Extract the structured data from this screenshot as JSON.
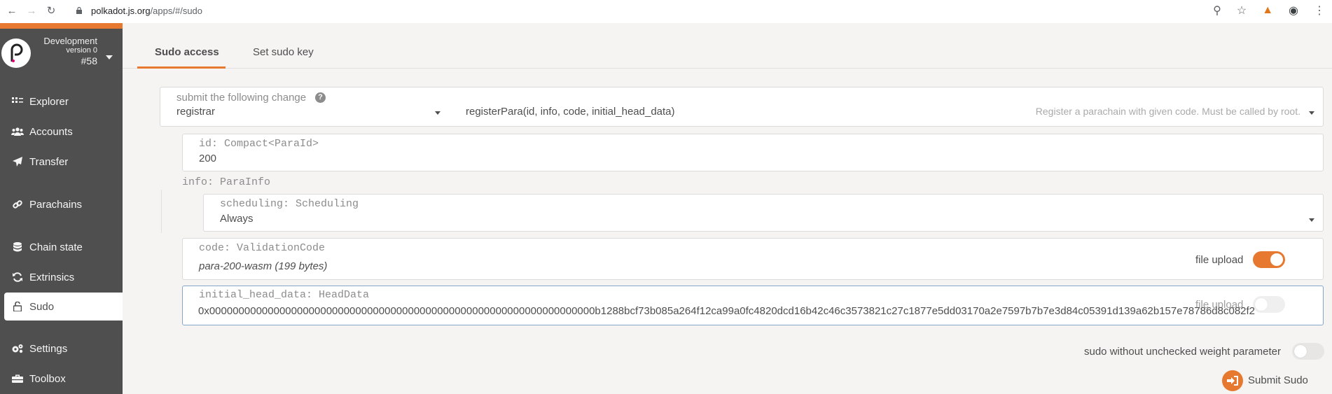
{
  "browser": {
    "url_host": "polkadot.js.org",
    "url_path": "/apps/#/sudo"
  },
  "sidebar": {
    "chain_name": "Development",
    "chain_version": "version 0",
    "chain_block": "#58",
    "items": [
      {
        "label": "Explorer",
        "icon": "explorer-icon"
      },
      {
        "label": "Accounts",
        "icon": "users-icon"
      },
      {
        "label": "Transfer",
        "icon": "send-icon"
      },
      {
        "label": "Parachains",
        "icon": "link-icon"
      },
      {
        "label": "Chain state",
        "icon": "database-icon"
      },
      {
        "label": "Extrinsics",
        "icon": "sync-icon"
      },
      {
        "label": "Sudo",
        "icon": "unlock-icon"
      },
      {
        "label": "Settings",
        "icon": "cogs-icon"
      },
      {
        "label": "Toolbox",
        "icon": "toolbox-icon"
      }
    ]
  },
  "tabs": [
    {
      "label": "Sudo access"
    },
    {
      "label": "Set sudo key"
    }
  ],
  "form": {
    "submit_label": "submit the following change",
    "module": "registrar",
    "method": "registerPara(id, info, code, initial_head_data)",
    "method_doc": "Register a parachain with given code. Must be called by root.",
    "id_label": "id: Compact<ParaId>",
    "id_value": "200",
    "info_label": "info: ParaInfo",
    "scheduling_label": "scheduling: Scheduling",
    "scheduling_value": "Always",
    "code_label": "code: ValidationCode",
    "code_value": "para-200-wasm (199 bytes)",
    "file_upload_label": "file upload",
    "head_label": "initial_head_data: HeadData",
    "head_value": "0x000000000000000000000000000000000000000000000000000000000000000000b1288bcf73b085a264f12ca99a0fc4820dcd16b42c46c3573821c27c1877e5dd03170a2e7597b7b7e3d84c05391d139a62b157e78786d8c082f2",
    "unchecked_label": "sudo without unchecked weight parameter",
    "submit_button": "Submit Sudo"
  },
  "colors": {
    "accent": "#e6792f",
    "sidebar_bg": "#4f4f4f",
    "page_bg": "#f5f4f3"
  }
}
